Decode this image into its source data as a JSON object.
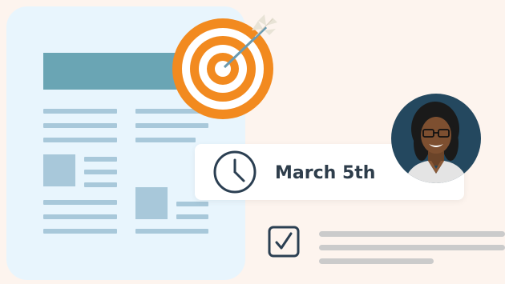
{
  "event": {
    "date_label": "March 5th"
  },
  "icons": {
    "target": "target-icon",
    "clock": "clock-icon",
    "checkbox": "checkbox-icon"
  },
  "colors": {
    "background": "#fdf4ee",
    "doc_card": "#e8f5fd",
    "doc_header": "#6aa5b4",
    "doc_lines": "#a8c8da",
    "target_orange": "#f28a1f",
    "dark_navy": "#2b3f52",
    "text_dark": "#2e3d4b",
    "task_lines": "#cbcbcb",
    "avatar_bg": "#24485f"
  }
}
